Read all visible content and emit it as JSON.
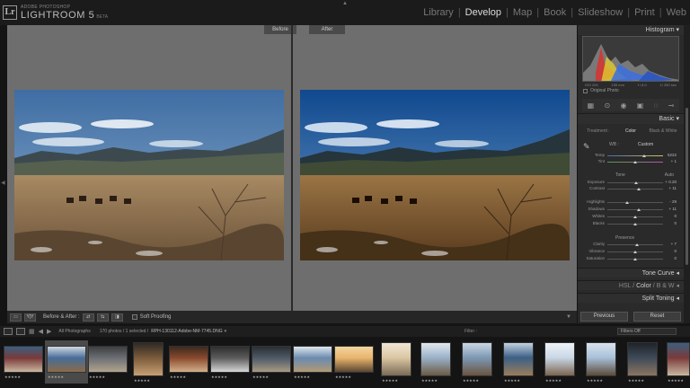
{
  "app": {
    "logo": "Lr",
    "brand_small": "ADOBE PHOTOSHOP",
    "brand_big": "LIGHTROOM 5",
    "brand_beta": "BETA"
  },
  "modules": [
    {
      "label": "Library",
      "active": false
    },
    {
      "label": "Develop",
      "active": true
    },
    {
      "label": "Map",
      "active": false
    },
    {
      "label": "Book",
      "active": false
    },
    {
      "label": "Slideshow",
      "active": false
    },
    {
      "label": "Print",
      "active": false
    },
    {
      "label": "Web",
      "active": false
    }
  ],
  "compare": {
    "before_label": "Before",
    "after_label": "After"
  },
  "toolbar": {
    "before_after_label": "Before & After :",
    "soft_proofing_label": "Soft Proofing",
    "view_mode": "Y|Y"
  },
  "right_panel": {
    "histogram_title": "Histogram",
    "histo_meta": [
      "ISO 200",
      "105 mm",
      "f / 8.0",
      "1/ 250 sec"
    ],
    "original_photo_label": "Original Photo",
    "basic_title": "Basic",
    "treatment": {
      "label": "Treatment :",
      "options": [
        "Color",
        "Black & White"
      ],
      "selected": "Color"
    },
    "wb": {
      "label": "WB :",
      "value": "Custom"
    },
    "sliders_wb": [
      {
        "label": "Temp",
        "value": "5222",
        "pos": 0.66
      },
      {
        "label": "Tint",
        "value": "+ 1",
        "pos": 0.5
      }
    ],
    "tone": {
      "label": "Tone",
      "auto": "Auto"
    },
    "sliders_tone": [
      {
        "label": "Exposure",
        "value": "+ 0.20",
        "pos": 0.52
      },
      {
        "label": "Contrast",
        "value": "+ 11",
        "pos": 0.56
      }
    ],
    "sliders_tone2": [
      {
        "label": "Highlights",
        "value": "- 29",
        "pos": 0.36
      },
      {
        "label": "Shadows",
        "value": "+ 11",
        "pos": 0.56
      },
      {
        "label": "Whites",
        "value": "0",
        "pos": 0.5
      },
      {
        "label": "Blacks",
        "value": "0",
        "pos": 0.5
      }
    ],
    "presence_label": "Presence",
    "sliders_presence": [
      {
        "label": "Clarity",
        "value": "+ 7",
        "pos": 0.54
      },
      {
        "label": "Vibrance",
        "value": "0",
        "pos": 0.5
      },
      {
        "label": "Saturation",
        "value": "0",
        "pos": 0.5
      }
    ],
    "tone_curve": "Tone Curve",
    "hsl": [
      "HSL",
      "Color",
      "B & W"
    ],
    "split_toning": "Split Toning",
    "previous": "Previous",
    "reset": "Reset"
  },
  "filmstrip": {
    "source": "All Photographs",
    "count": "170 photos / 1 selected /",
    "filename": "RPH-130112-Adobe-NM-7745.DNG",
    "filter_label": "Filter :",
    "filter_value": "Filters Off",
    "stars": "★★★★★"
  },
  "colors": {
    "accent": "#dddddd",
    "panel_bg": "#2a2a2a",
    "canvas_bg": "#6e6e6e"
  }
}
